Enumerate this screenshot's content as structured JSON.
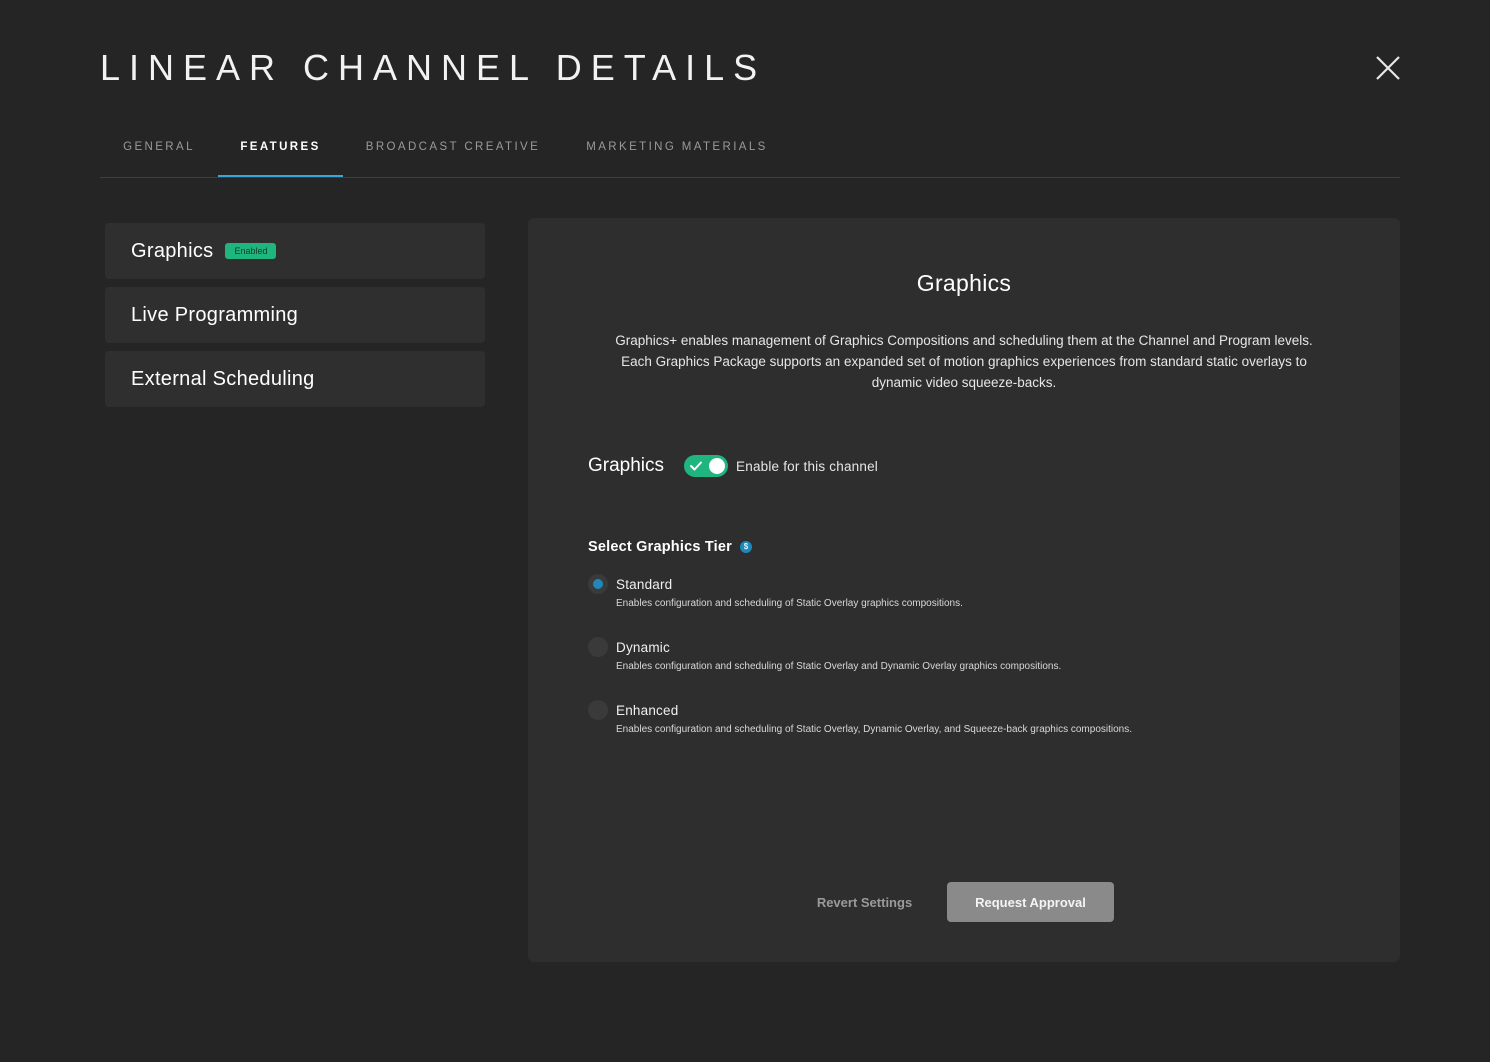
{
  "header": {
    "title": "LINEAR CHANNEL DETAILS",
    "close_icon": "close-icon"
  },
  "tabs": [
    {
      "label": "GENERAL",
      "active": false
    },
    {
      "label": "FEATURES",
      "active": true
    },
    {
      "label": "BROADCAST CREATIVE",
      "active": false
    },
    {
      "label": "MARKETING MATERIALS",
      "active": false
    }
  ],
  "sidebar": {
    "items": [
      {
        "label": "Graphics",
        "badge": "Enabled"
      },
      {
        "label": "Live Programming"
      },
      {
        "label": "External Scheduling"
      }
    ]
  },
  "panel": {
    "title": "Graphics",
    "description": "Graphics+ enables management of Graphics Compositions and scheduling them at the Channel and Program levels. Each Graphics Package supports an expanded set of motion graphics experiences from standard static overlays to dynamic video squeeze-backs.",
    "feature_label": "Graphics",
    "toggle": {
      "on": true,
      "text": "Enable for this channel"
    },
    "tier_heading": "Select Graphics Tier",
    "info_icon": "$",
    "options": [
      {
        "label": "Standard",
        "description": "Enables configuration and scheduling of Static Overlay graphics compositions.",
        "selected": true
      },
      {
        "label": "Dynamic",
        "description": "Enables configuration and scheduling of Static Overlay and Dynamic Overlay graphics compositions.",
        "selected": false
      },
      {
        "label": "Enhanced",
        "description": "Enables configuration and scheduling of Static Overlay, Dynamic Overlay, and Squeeze-back graphics compositions.",
        "selected": false
      }
    ],
    "revert_label": "Revert Settings",
    "approve_label": "Request Approval"
  },
  "colors": {
    "background": "#252525",
    "panel": "#2e2e2e",
    "accent_blue": "#3ba4d8",
    "success_green": "#1fb57e",
    "button_gray": "#8a8a8a"
  }
}
